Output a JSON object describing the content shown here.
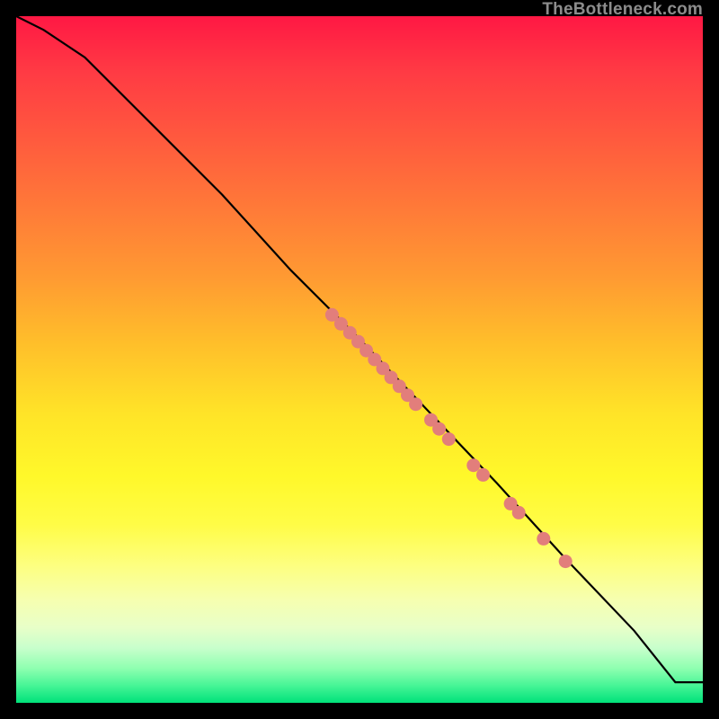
{
  "watermark": "TheBottleneck.com",
  "chart_data": {
    "type": "line",
    "title": "",
    "xlabel": "",
    "ylabel": "",
    "xlim": [
      0,
      100
    ],
    "ylim": [
      0,
      100
    ],
    "grid": false,
    "legend": false,
    "series": [
      {
        "name": "curve",
        "x": [
          0,
          4,
          10,
          20,
          30,
          40,
          50,
          60,
          70,
          80,
          90,
          96,
          100
        ],
        "y": [
          100,
          98,
          94,
          84,
          74,
          63,
          53,
          42.5,
          32,
          21,
          10.5,
          3,
          3
        ]
      }
    ],
    "points": [
      {
        "x": 46.0,
        "y": 56.5
      },
      {
        "x": 47.3,
        "y": 55.2
      },
      {
        "x": 48.6,
        "y": 53.9
      },
      {
        "x": 49.8,
        "y": 52.6
      },
      {
        "x": 51.0,
        "y": 51.3
      },
      {
        "x": 52.2,
        "y": 50.0
      },
      {
        "x": 53.4,
        "y": 48.7
      },
      {
        "x": 54.6,
        "y": 47.4
      },
      {
        "x": 55.8,
        "y": 46.1
      },
      {
        "x": 57.0,
        "y": 44.8
      },
      {
        "x": 58.2,
        "y": 43.5
      },
      {
        "x": 60.4,
        "y": 41.2
      },
      {
        "x": 61.6,
        "y": 39.9
      },
      {
        "x": 63.0,
        "y": 38.4
      },
      {
        "x": 66.6,
        "y": 34.6
      },
      {
        "x": 68.0,
        "y": 33.2
      },
      {
        "x": 72.0,
        "y": 29.0
      },
      {
        "x": 73.2,
        "y": 27.7
      },
      {
        "x": 76.8,
        "y": 23.9
      },
      {
        "x": 80.0,
        "y": 20.6
      }
    ],
    "point_radius": 7.5
  }
}
